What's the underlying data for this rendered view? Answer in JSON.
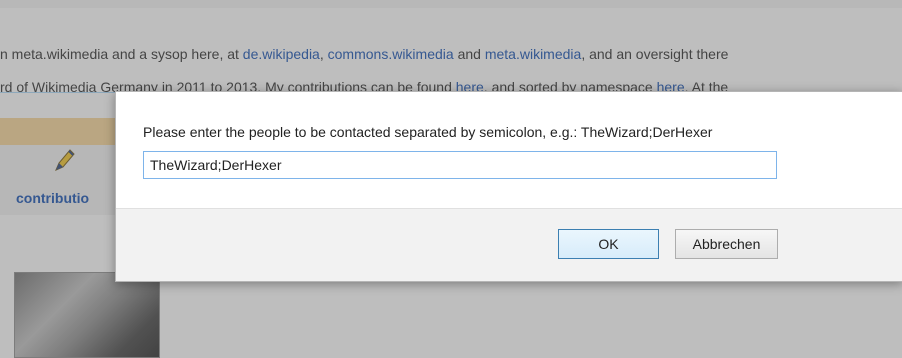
{
  "background_page": {
    "line1": {
      "seg1": "n meta.wikimedia and a sysop here, at ",
      "link1": "de.wikipedia",
      "seg2": ", ",
      "link2": "commons.wikimedia",
      "seg3": " and ",
      "link3": "meta.wikimedia",
      "seg4": ", and an oversight there"
    },
    "line2": {
      "seg1": "rd of Wikimedia Germany in 2011 to 2013. My contributions can be found ",
      "link1": "here",
      "seg2": ", and sorted by namespace ",
      "link2": "here",
      "seg3": ". At the"
    },
    "contributions_label": "contributio",
    "icon": "pencil-icon"
  },
  "dialog": {
    "prompt": "Please enter the people to be contacted separated by semicolon, e.g.: TheWizard;DerHexer",
    "input_value": "TheWizard;DerHexer",
    "ok_label": "OK",
    "cancel_label": "Abbrechen",
    "colors": {
      "input_border": "#7eb4ea",
      "ok_border": "#3c7fb1",
      "footer_bg": "#f2f2f2"
    }
  }
}
